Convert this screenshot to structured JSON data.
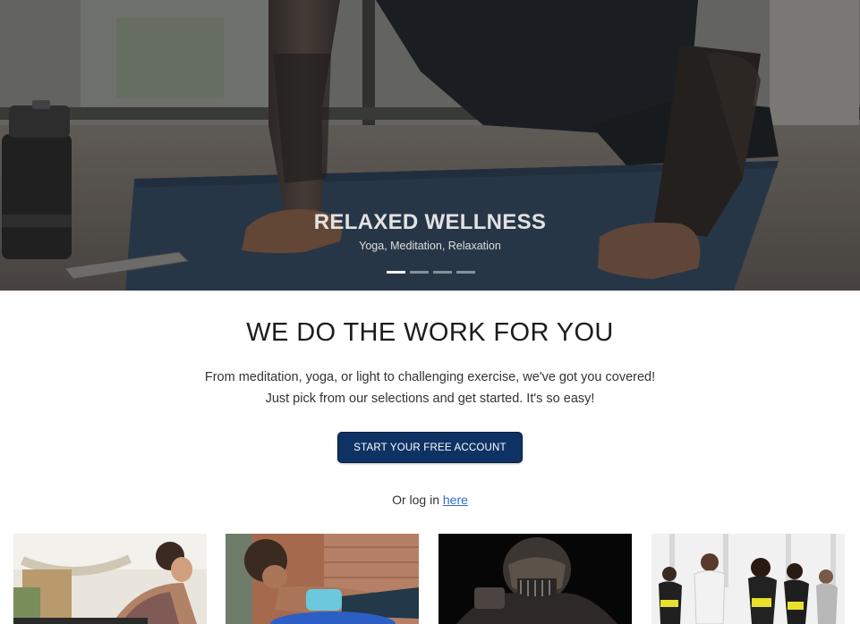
{
  "hero": {
    "title": "RELAXED WELLNESS",
    "subtitle": "Yoga, Meditation, Relaxation",
    "indicators": 4,
    "active_indicator": 0
  },
  "intro": {
    "heading": "WE DO THE WORK FOR YOU",
    "line1": "From meditation, yoga, or light to challenging exercise, we've got you covered!",
    "line2": "Just pick from our selections and get started. It's so easy!",
    "cta_label": "START YOUR FREE ACCOUNT",
    "login_prefix": "Or log in",
    "login_link": "here"
  },
  "colors": {
    "cta": "#0e3264",
    "link": "#2e6cc4",
    "heading": "#1c1c1c"
  }
}
